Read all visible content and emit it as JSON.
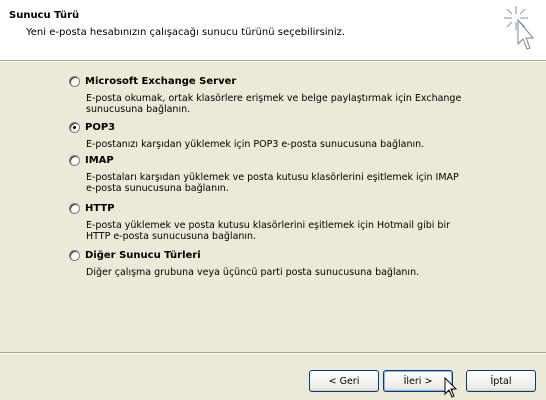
{
  "header": {
    "title": "Sunucu Türü",
    "subtitle": "Yeni e-posta hesabınızın çalışacağı sunucu türünü seçebilirsiniz."
  },
  "options": [
    {
      "label": "Microsoft Exchange Server",
      "description": "E-posta okumak, ortak klasörlere erişmek ve belge paylaştırmak için Exchange sunucusuna bağlanın.",
      "selected": false
    },
    {
      "label": "POP3",
      "description": "E-postanızı karşıdan yüklemek için POP3 e-posta sunucusuna bağlanın.",
      "selected": true
    },
    {
      "label": "IMAP",
      "description": "E-postaları karşıdan yüklemek ve posta kutusu klasörlerini eşitlemek için IMAP e-posta sunucusuna bağlanın.",
      "selected": false
    },
    {
      "label": "HTTP",
      "description": "E-posta yüklemek ve posta kutusu klasörlerini eşitlemek için Hotmail gibi bir HTTP e-posta sunucusuna bağlanın.",
      "selected": false
    },
    {
      "label": "Diğer Sunucu Türleri",
      "description": "Diğer çalışma grubuna veya üçüncü parti posta sunucusuna bağlanın.",
      "selected": false
    }
  ],
  "buttons": {
    "back": "< Geri",
    "next": "İleri >",
    "cancel": "İptal"
  },
  "icons": {
    "wizard": "wizard-sparkle-cursor-icon",
    "pointer": "mouse-pointer-icon"
  }
}
